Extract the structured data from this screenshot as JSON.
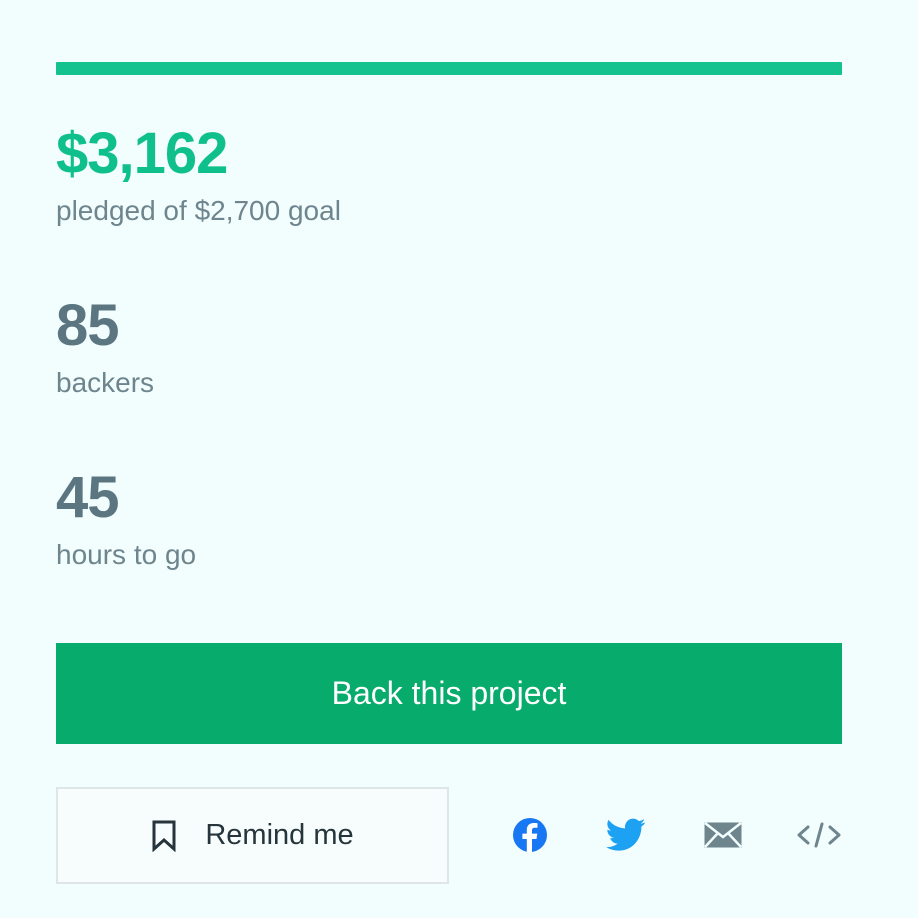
{
  "funding": {
    "pledged_amount": "$3,162",
    "pledged_label": "pledged of $2,700 goal",
    "progress_percent": 100,
    "backers_count": "85",
    "backers_label": "backers",
    "time_left": "45",
    "time_left_label": "hours to go"
  },
  "actions": {
    "back_label": "Back this project",
    "remind_label": "Remind me",
    "remind_icon": "bookmark-icon"
  },
  "share": {
    "icons": [
      "facebook-icon",
      "twitter-icon",
      "email-icon",
      "embed-code-icon"
    ]
  },
  "colors": {
    "accent": "#13c28e",
    "button": "#07ab6b",
    "background": "#f2fdfd",
    "facebook": "#1877f2",
    "twitter": "#1da1f2"
  }
}
